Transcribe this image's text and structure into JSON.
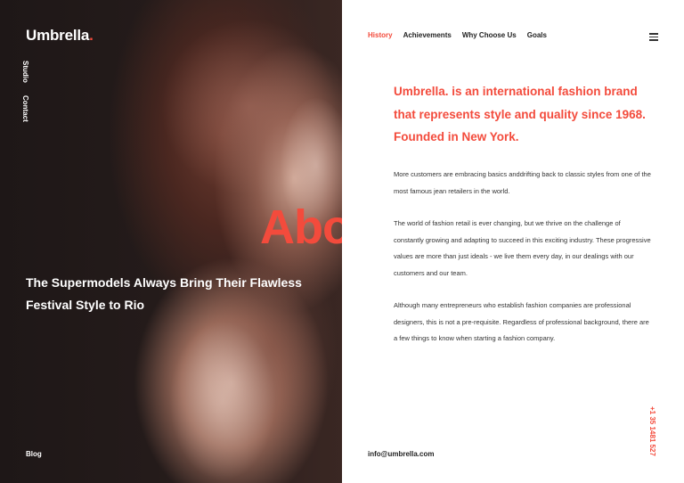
{
  "brand": {
    "name": "Umbrella",
    "dot": "."
  },
  "side_nav": [
    "Studio",
    "Contact"
  ],
  "hero": {
    "title": "The Supermodels Always Bring Their Flawless Festival Style to Rio",
    "overlay_word": "Abo"
  },
  "footer_left": {
    "blog": "Blog"
  },
  "tabs": [
    "History",
    "Achievements",
    "Why Choose Us",
    "Goals"
  ],
  "content": {
    "lead": "Umbrella. is an international fashion brand that represents style and quality since 1968. Founded in New York.",
    "paragraphs": [
      "More customers are embracing basics anddrifting back to classic styles from one of the most famous jean retailers in the world.",
      "The world of fashion retail is ever changing, but we thrive on the challenge of constantly growing and adapting to succeed in this exciting industry. These progressive values are more than just ideals - we live them every day, in our dealings with our customers and our team.",
      "Although many entrepreneurs who establish fashion companies are professional designers, this is not a pre-requisite. Regardless of professional background, there are a few things to know when starting a fashion company."
    ]
  },
  "contact": {
    "email": "info@umbrella.com",
    "phone": "+1 35 1481 527"
  },
  "colors": {
    "accent": "#f34b3c",
    "dark": "#1e1717"
  },
  "icons": {
    "menu": "hamburger-menu-icon"
  }
}
